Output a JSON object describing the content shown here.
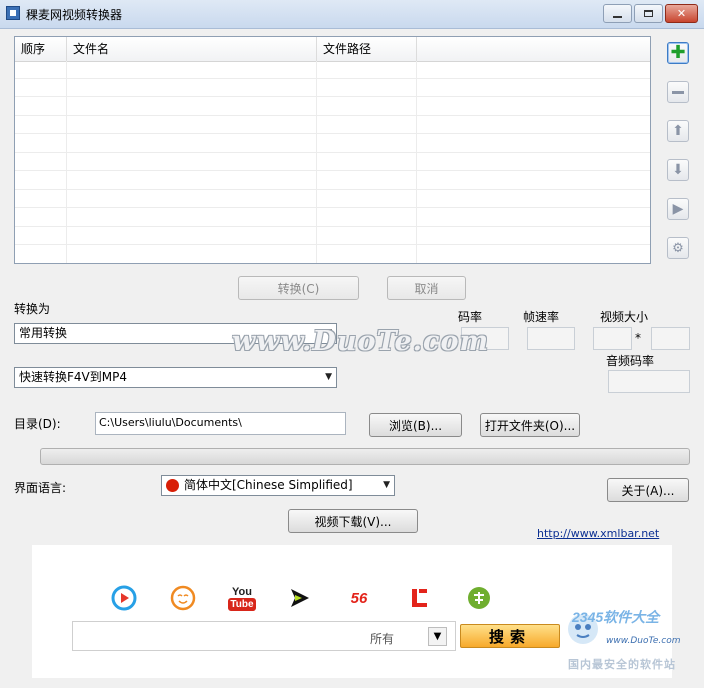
{
  "window": {
    "title": "稞麦网视频转换器"
  },
  "list": {
    "columns": [
      "顺序",
      "文件名",
      "文件路径",
      ""
    ]
  },
  "actions": {
    "convert_label": "转换(C)",
    "cancel_label": "取消"
  },
  "convert_to": {
    "label": "转换为",
    "category_selected": "常用转换",
    "preset_selected": "快速转换F4V到MP4"
  },
  "params": {
    "bitrate_label": "码率",
    "framerate_label": "帧速率",
    "size_label": "视频大小",
    "size_sep": "*",
    "audio_bitrate_label": "音频码率"
  },
  "output": {
    "dir_label": "目录(D):",
    "dir_value": "C:\\Users\\liulu\\Documents\\",
    "browse_label": "浏览(B)...",
    "open_folder_label": "打开文件夹(O)..."
  },
  "ui_language": {
    "label": "界面语言:",
    "selected": "简体中文[Chinese Simplified]"
  },
  "about_label": "关于(A)...",
  "video_download_label": "视频下载(V)...",
  "website_link": "http://www.xmlbar.net",
  "watermark": "www.DuoTe.com",
  "search": {
    "placeholder": "",
    "scope_selected": "所有",
    "button_label": "搜索"
  },
  "site_icons": [
    "youku-icon",
    "tudou-icon",
    "youtube-icon",
    "iqiyi-icon",
    "56-icon",
    "letv-icon",
    "qiyi-icon"
  ],
  "youtube_text": {
    "you": "You",
    "tube": "Tube"
  },
  "site_56_text": "56",
  "brand": {
    "name": "2345软件大全",
    "url": "www.DuoTe.com",
    "slogan": "国内最安全的软件站"
  },
  "colors": {
    "accent_blue": "#3a6fb5",
    "link": "#0b2f92",
    "search_button": "#f7a92b"
  }
}
